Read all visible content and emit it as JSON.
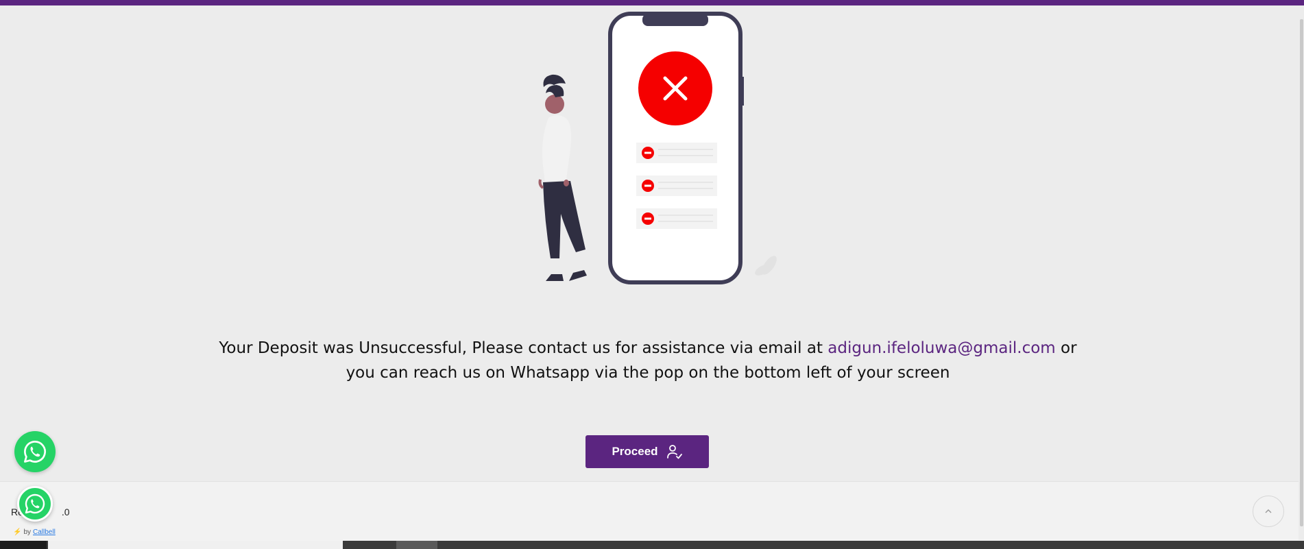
{
  "message": {
    "before_email": "Your Deposit was Unsuccessful, Please contact us for assistance via email at ",
    "email": "adigun.ifeloluwa@gmail.com",
    "after_email": " or you can reach us on Whatsapp via the pop on the bottom left of your screen"
  },
  "proceed_button": {
    "label": "Proceed",
    "icon": "user-check-icon"
  },
  "footer": {
    "text": "Re",
    "text_suffix": ".0"
  },
  "whatsapp": {
    "icon": "whatsapp-icon",
    "powered_by": "by",
    "provider": "Callbell"
  },
  "scroll_top": {
    "icon": "chevron-up-icon"
  },
  "illustration": {
    "status_icon": "close-icon",
    "list_icon": "minus-circle-icon"
  },
  "colors": {
    "brand": "#5b2580",
    "error": "#f50000",
    "whatsapp": "#25d366",
    "background": "#ececec"
  }
}
